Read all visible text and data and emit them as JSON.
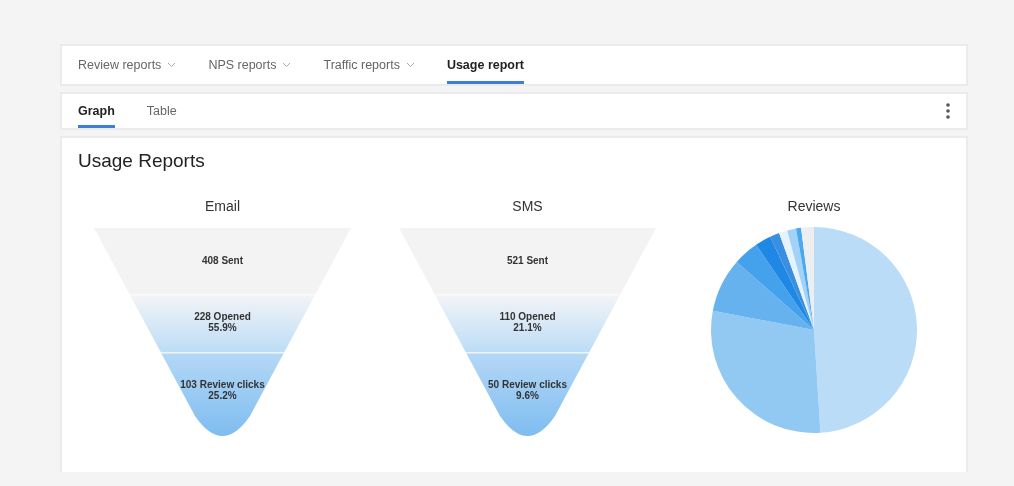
{
  "report_tabs": [
    {
      "label": "Review reports",
      "dropdown": true,
      "selected": false
    },
    {
      "label": "NPS reports",
      "dropdown": true,
      "selected": false
    },
    {
      "label": "Traffic reports",
      "dropdown": true,
      "selected": false
    },
    {
      "label": "Usage report",
      "dropdown": false,
      "selected": true
    }
  ],
  "view_tabs": [
    {
      "label": "Graph",
      "selected": true
    },
    {
      "label": "Table",
      "selected": false
    }
  ],
  "title": "Usage Reports",
  "funnels": [
    {
      "title": "Email",
      "stages": [
        {
          "label": "408 Sent"
        },
        {
          "label": "228 Opened",
          "percent": "55.9%"
        },
        {
          "label": "103 Review clicks",
          "percent": "25.2%"
        }
      ]
    },
    {
      "title": "SMS",
      "stages": [
        {
          "label": "521 Sent"
        },
        {
          "label": "110 Opened",
          "percent": "21.1%"
        },
        {
          "label": "50 Review clicks",
          "percent": "9.6%"
        }
      ]
    }
  ],
  "pie": {
    "title": "Reviews"
  }
}
